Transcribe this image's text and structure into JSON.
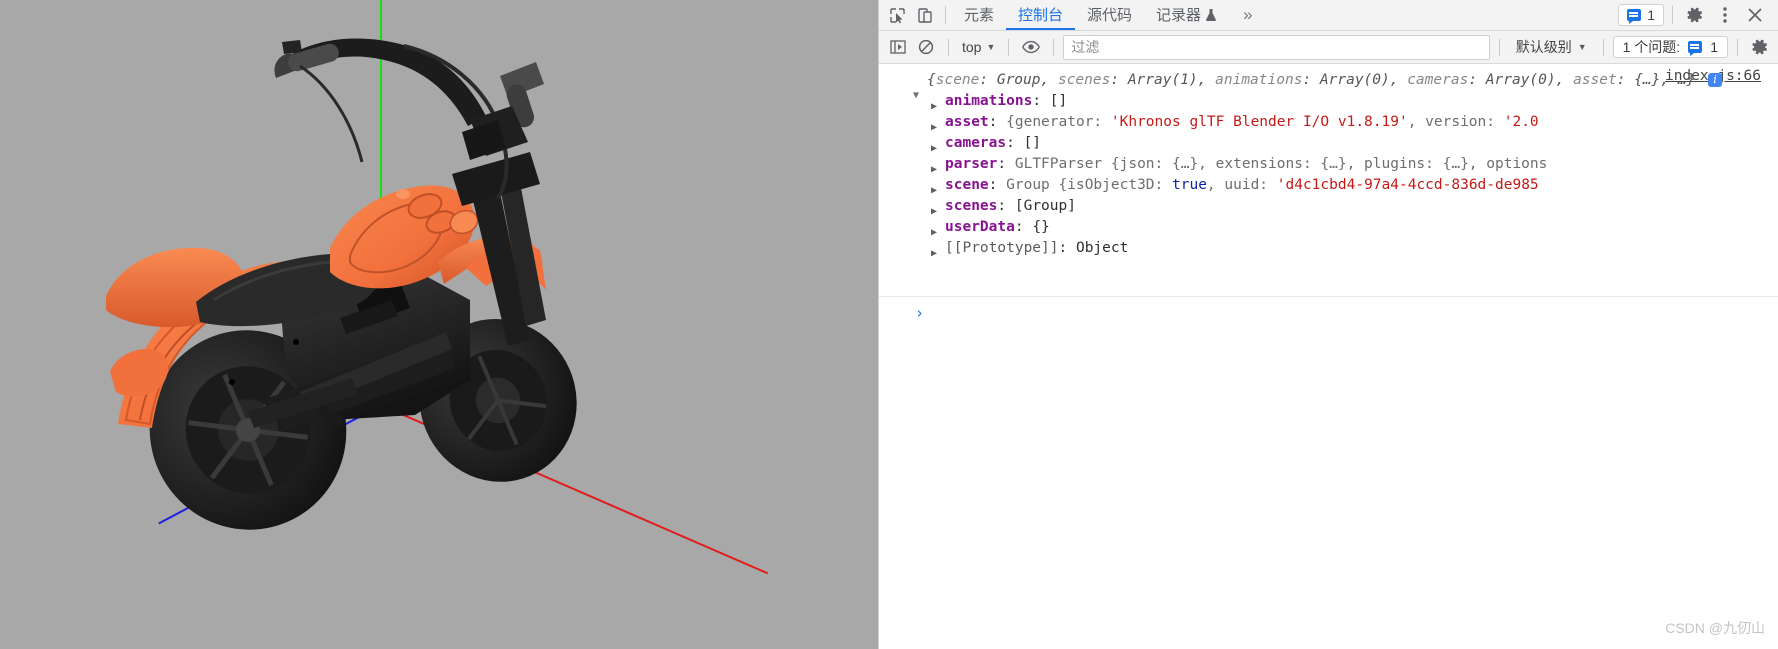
{
  "viewport": {
    "name": "three-js-3d-viewport",
    "background_color": "#a8a8a8",
    "model": "motorcycle",
    "model_body_color": "#f2703c",
    "model_dark_color": "#222222",
    "axes": [
      {
        "name": "y-axis",
        "color": "#12e212"
      },
      {
        "name": "x-axis",
        "color": "#e21b1b"
      },
      {
        "name": "z-axis",
        "color": "#1b20e2"
      }
    ]
  },
  "devtools": {
    "toolbar": {
      "inspect_icon": "inspect-element-icon",
      "device_icon": "device-toolbar-icon",
      "tabs": [
        {
          "label": "元素",
          "active": false
        },
        {
          "label": "控制台",
          "active": true
        },
        {
          "label": "源代码",
          "active": false
        },
        {
          "label": "记录器",
          "active": false,
          "suffix_icon": "flask-icon"
        }
      ],
      "more_tabs": "»",
      "issues_count": "1",
      "issues_icon": "message-badge-icon",
      "settings_icon": "gear-icon",
      "more_icon": "kebab-menu-icon",
      "close_icon": "close-icon"
    },
    "console_bar": {
      "sidebar_icon": "console-sidebar-icon",
      "clear_icon": "clear-console-icon",
      "context": "top",
      "context_caret": "▼",
      "eye_icon": "live-expression-eye-icon",
      "filter_placeholder": "过滤",
      "filter_value": "",
      "level": "默认级别",
      "level_caret": "▼",
      "issues_label": "1 个问题:",
      "issues_count": "1",
      "settings_icon": "gear-icon"
    },
    "console_log": {
      "source_link": "index.js:66",
      "expand_triangle": "▼",
      "preview_line1_open": "{",
      "preview": [
        {
          "key": "scene",
          "val": "Group"
        },
        {
          "key": "scenes",
          "val": "Array(1)"
        },
        {
          "key": "animations",
          "val": "Array(0)"
        },
        {
          "key": "cameras",
          "val": "Array(0)"
        },
        {
          "key": "asset",
          "val": "{…}"
        }
      ],
      "preview_tail": ", …}",
      "info_icon": "i",
      "properties": [
        {
          "triangle": "▶",
          "name": "animations",
          "segments": [
            {
              "text": ": ",
              "kind": "colon"
            },
            {
              "text": "[]",
              "kind": "plain"
            }
          ]
        },
        {
          "triangle": "▶",
          "name": "asset",
          "segments": [
            {
              "text": ": ",
              "kind": "colon"
            },
            {
              "text": "{generator: ",
              "kind": "gray"
            },
            {
              "text": "'Khronos glTF Blender I/O v1.8.19'",
              "kind": "str"
            },
            {
              "text": ", version: ",
              "kind": "gray"
            },
            {
              "text": "'2.0",
              "kind": "str"
            }
          ]
        },
        {
          "triangle": "▶",
          "name": "cameras",
          "segments": [
            {
              "text": ": ",
              "kind": "colon"
            },
            {
              "text": "[]",
              "kind": "plain"
            }
          ]
        },
        {
          "triangle": "▶",
          "name": "parser",
          "segments": [
            {
              "text": ": ",
              "kind": "colon"
            },
            {
              "text": "GLTFParser {json: {…}, extensions: {…}, plugins: {…}, options",
              "kind": "gray"
            }
          ]
        },
        {
          "triangle": "▶",
          "name": "scene",
          "segments": [
            {
              "text": ": ",
              "kind": "colon"
            },
            {
              "text": "Group {isObject3D: ",
              "kind": "gray"
            },
            {
              "text": "true",
              "kind": "bool"
            },
            {
              "text": ", uuid: ",
              "kind": "gray"
            },
            {
              "text": "'d4c1cbd4-97a4-4ccd-836d-de985",
              "kind": "str"
            }
          ]
        },
        {
          "triangle": "▶",
          "name": "scenes",
          "segments": [
            {
              "text": ": ",
              "kind": "colon"
            },
            {
              "text": "[Group]",
              "kind": "plain"
            }
          ]
        },
        {
          "triangle": "▶",
          "name": "userData",
          "segments": [
            {
              "text": ": ",
              "kind": "colon"
            },
            {
              "text": "{}",
              "kind": "plain"
            }
          ]
        },
        {
          "triangle": "▶",
          "name": "[[Prototype]]",
          "name_style": "proto",
          "segments": [
            {
              "text": ": ",
              "kind": "colon"
            },
            {
              "text": "Object",
              "kind": "plain"
            }
          ]
        }
      ],
      "prompt_symbol": "›"
    },
    "watermark": "CSDN @九仞山"
  }
}
